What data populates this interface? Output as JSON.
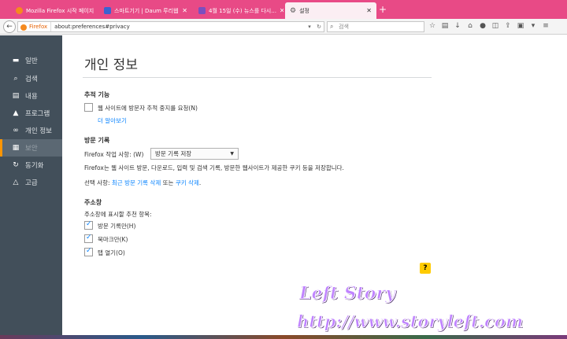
{
  "tabs": [
    {
      "label": "Mozilla Firefox 시작 페이지",
      "color": "#f58a1f"
    },
    {
      "label": "스마트기기 | Daum 루리웹",
      "color": "#3b63d1"
    },
    {
      "label": "4월 15일 (수) 뉴스를 다시...",
      "color": "#7b4fbf"
    },
    {
      "label": "설정",
      "color": "#777777"
    }
  ],
  "nav": {
    "identity_label": "Firefox",
    "url": "about:preferences#privacy",
    "search_placeholder": "검색"
  },
  "sidebar": {
    "items": [
      {
        "label": "일반",
        "icon": "monitor-icon"
      },
      {
        "label": "검색",
        "icon": "search-icon"
      },
      {
        "label": "내용",
        "icon": "document-icon"
      },
      {
        "label": "프로그램",
        "icon": "rocket-icon"
      },
      {
        "label": "개인 정보",
        "icon": "mask-icon"
      },
      {
        "label": "보안",
        "icon": "lock-icon"
      },
      {
        "label": "동기화",
        "icon": "sync-icon"
      },
      {
        "label": "고급",
        "icon": "wizard-icon"
      }
    ],
    "selected_index": 4
  },
  "page": {
    "title": "개인 정보",
    "tracking": {
      "heading": "추적 기능",
      "dnt_label": "웹 사이트에 방문자 추적 중지를 요청(N)",
      "dnt_checked": false,
      "learn_more": "더 알아보기"
    },
    "history": {
      "heading": "방문 기록",
      "will_label": "Firefox 작업 사항: (W)",
      "select_value": "방문 기록 저장",
      "description": "Firefox는 웹 사이트 방문, 다운로드, 입력 및 검색 기록, 방문한 웹사이트가 제공한 쿠키 등을 저장합니다.",
      "option_prefix": "선택 사항:",
      "clear_recent_link": "최근 방문 기록 삭제",
      "or_text": "또는",
      "remove_cookies_link": "쿠키 삭제",
      "period": "."
    },
    "location_bar": {
      "heading": "주소창",
      "suggest_label": "주소창에 표시할 추천 항목:",
      "options": [
        {
          "label": "방문 기록만(H)",
          "checked": true
        },
        {
          "label": "북마크만(K)",
          "checked": true
        },
        {
          "label": "탭 열기(O)",
          "checked": true
        }
      ]
    },
    "help_label": "?"
  },
  "watermark": {
    "line1": "Left Story",
    "line2": "http://www.storyleft.com"
  },
  "colors": {
    "tabbar": "#e84a86",
    "sidebar": "#424f5a",
    "accent": "#ff9500",
    "link": "#0a84ff"
  }
}
